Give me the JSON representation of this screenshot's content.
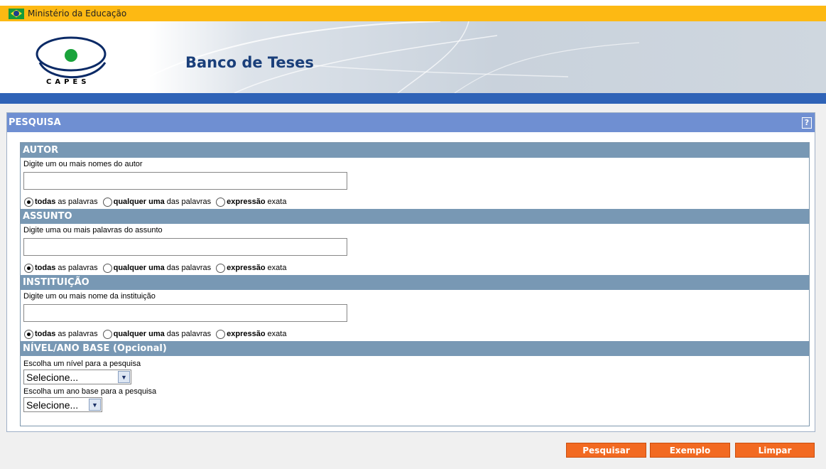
{
  "gov_bar": {
    "text": "Ministério da Educação"
  },
  "banner": {
    "logo_text": "CAPES",
    "title": "Banco de Teses"
  },
  "panel": {
    "title": "PESQUISA",
    "help_label": "?"
  },
  "sections": {
    "autor": {
      "title": "AUTOR",
      "label": "Digite um ou mais nomes do autor",
      "value": "",
      "options": [
        {
          "bold": "todas",
          "rest": "as palavras",
          "checked": true
        },
        {
          "bold": "qualquer uma",
          "rest": "das palavras",
          "checked": false
        },
        {
          "bold": "expressão",
          "rest": "exata",
          "checked": false
        }
      ]
    },
    "assunto": {
      "title": "ASSUNTO",
      "label": "Digite uma ou mais palavras do assunto",
      "value": "",
      "options": [
        {
          "bold": "todas",
          "rest": "as palavras",
          "checked": true
        },
        {
          "bold": "qualquer uma",
          "rest": "das palavras",
          "checked": false
        },
        {
          "bold": "expressão",
          "rest": "exata",
          "checked": false
        }
      ]
    },
    "instituicao": {
      "title": "INSTITUIÇÃO",
      "label": "Digite um ou mais nome da instituição",
      "value": "",
      "options": [
        {
          "bold": "todas",
          "rest": "as palavras",
          "checked": true
        },
        {
          "bold": "qualquer uma",
          "rest": "das palavras",
          "checked": false
        },
        {
          "bold": "expressão",
          "rest": "exata",
          "checked": false
        }
      ]
    },
    "nivel": {
      "title": "NÍVEL/ANO BASE (Opcional)",
      "nivel_label": "Escolha um nível para a pesquisa",
      "nivel_selected": "Selecione...",
      "ano_label": "Escolha um ano base para a pesquisa",
      "ano_selected": "Selecione..."
    }
  },
  "buttons": {
    "pesquisar": "Pesquisar",
    "exemplo": "Exemplo",
    "limpar": "Limpar"
  },
  "colors": {
    "accent_orange": "#f26a22",
    "panel_header": "#6f8fd2",
    "section_header": "#7898b4",
    "gov_bar": "#fdb913",
    "strip_blue": "#2f63b7"
  }
}
